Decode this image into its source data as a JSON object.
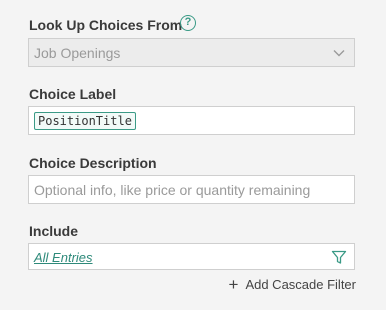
{
  "lookup": {
    "label": "Look Up Choices From",
    "help_icon": "question-circle-icon",
    "selected_value": "Job Openings",
    "dropdown_icon": "chevron-down-icon"
  },
  "choice_label": {
    "label": "Choice Label",
    "token": "PositionTitle"
  },
  "choice_description": {
    "label": "Choice Description",
    "placeholder": "Optional info, like price or quantity remaining"
  },
  "include": {
    "label": "Include",
    "value": "All Entries",
    "filter_icon": "filter-icon"
  },
  "cascade": {
    "add_label": "Add Cascade Filter",
    "icon": "plus-icon"
  },
  "colors": {
    "accent": "#3a9a86",
    "background": "#f4f4f4"
  }
}
